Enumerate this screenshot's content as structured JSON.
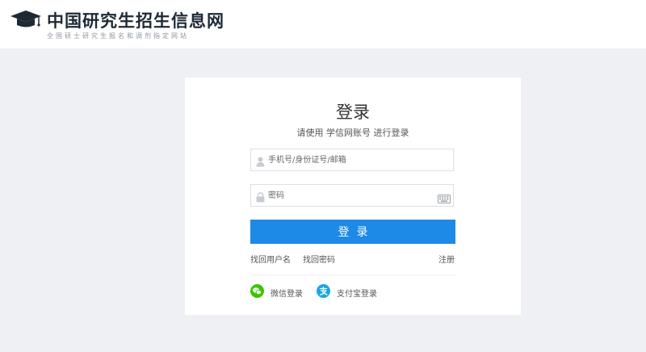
{
  "header": {
    "logo_title": "中国研究生招生信息网",
    "logo_subtitle": "全国硕士研究生报名和调剂指定网站"
  },
  "login": {
    "title": "登录",
    "subtitle": "请使用 学信网账号 进行登录",
    "username_placeholder": "手机号/身份证号/邮箱",
    "password_placeholder": "密码",
    "submit_label": "登录",
    "find_username": "找回用户名",
    "find_password": "找回密码",
    "register": "注册",
    "wechat_login": "微信登录",
    "alipay_login": "支付宝登录"
  },
  "colors": {
    "primary_button": "#1c8ae6",
    "wechat": "#3fc400",
    "alipay": "#1aa5e9",
    "background": "#eef0f3"
  },
  "icons": {
    "logo": "graduation-cap-icon",
    "username": "user-icon",
    "password": "lock-icon",
    "keyboard": "keyboard-icon",
    "wechat": "wechat-icon",
    "alipay": "alipay-icon"
  }
}
